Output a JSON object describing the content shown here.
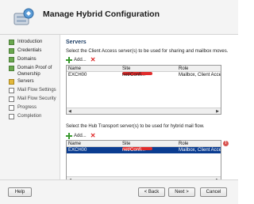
{
  "window": {
    "title": "Manage Hybrid Configuration"
  },
  "nav": {
    "items": [
      {
        "label": "Introduction",
        "status": "done"
      },
      {
        "label": "Credentials",
        "status": "done"
      },
      {
        "label": "Domains",
        "status": "done"
      },
      {
        "label": "Domain Proof of Ownership",
        "status": "done"
      },
      {
        "label": "Servers",
        "status": "current"
      },
      {
        "label": "Mail Flow Settings",
        "status": "pending"
      },
      {
        "label": "Mail Flow Security",
        "status": "pending"
      },
      {
        "label": "Progress",
        "status": "pending"
      },
      {
        "label": "Completion",
        "status": "pending"
      }
    ]
  },
  "main": {
    "section_title": "Servers",
    "cas": {
      "description": "Select the Client Access server(s) to be used for sharing and mailbox moves.",
      "add_label": "Add...",
      "columns": [
        "Name",
        "Site",
        "Role"
      ],
      "rows": [
        {
          "name": "EXCH00",
          "site_suffix": "net/Confi...",
          "role": "Mailbox, Client Access, Hu",
          "selected": false
        }
      ]
    },
    "hub": {
      "description": "Select the Hub Transport server(s) to be used for hybrid mail flow.",
      "add_label": "Add...",
      "columns": [
        "Name",
        "Site",
        "Role"
      ],
      "rows": [
        {
          "name": "EXCH00",
          "site_suffix": "net/Confi...",
          "role": "Mailbox, Client Access, Hu",
          "selected": true
        }
      ]
    }
  },
  "footer": {
    "help_label": "Help",
    "back_label": "< Back",
    "next_label": "Next >",
    "cancel_label": "Cancel"
  },
  "colors": {
    "selection": "#0b3d91",
    "done": "#6aa84f",
    "current": "#e3b83a",
    "remove": "#dd2222",
    "add": "#3a9a2f"
  }
}
